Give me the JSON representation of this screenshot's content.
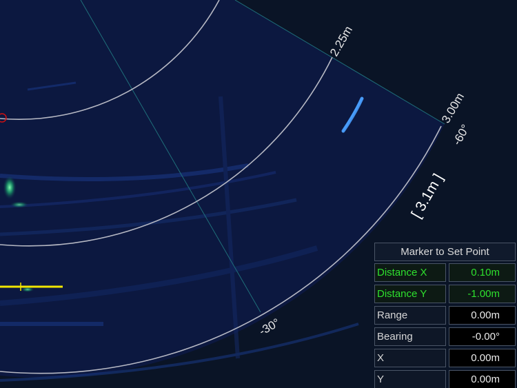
{
  "sonar": {
    "range_labels": [
      "2.25m",
      "3.00m"
    ],
    "bearing_labels": [
      "-60°",
      "-30°"
    ],
    "range_setting": "[ 3.1m ]",
    "colors": {
      "background": "#0a1426",
      "sector": "#0c1840",
      "range_rings": "#b7b9c4",
      "bearing_lines": "#1f6f7a",
      "marker": "#f2e600",
      "set_point_marker": "#d01010"
    }
  },
  "panel": {
    "title": "Marker to Set Point",
    "rows": [
      {
        "label": "Distance X",
        "value": "0.10m",
        "highlight": true
      },
      {
        "label": "Distance Y",
        "value": "-1.00m",
        "highlight": true
      },
      {
        "label": "Range",
        "value": "0.00m",
        "highlight": false
      },
      {
        "label": "Bearing",
        "value": "-0.00°",
        "highlight": false
      },
      {
        "label": "X",
        "value": "0.00m",
        "highlight": false
      },
      {
        "label": "Y",
        "value": "0.00m",
        "highlight": false
      }
    ]
  }
}
